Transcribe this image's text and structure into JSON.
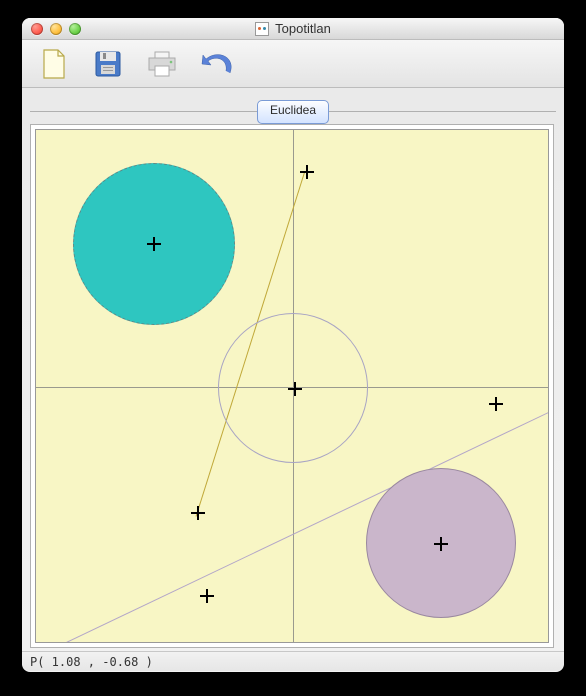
{
  "window": {
    "title": "Topotitlan"
  },
  "toolbar": {
    "new_label": "New",
    "save_label": "Save",
    "print_label": "Print",
    "undo_label": "Undo"
  },
  "tab": {
    "label": "Euclidea"
  },
  "status": {
    "text": "P( 1.08 , -0.68 )"
  },
  "geometry": {
    "axes": {
      "type": "cartesian"
    },
    "circles": [
      {
        "id": "teal-filled",
        "center_approx": [
          -0.95,
          0.95
        ],
        "filled": true
      },
      {
        "id": "center-outline",
        "center_approx": [
          0.0,
          0.0
        ],
        "filled": false
      },
      {
        "id": "lavender-filled",
        "center_approx": [
          1.0,
          -1.0
        ],
        "filled": true
      }
    ],
    "points": [
      {
        "approx": [
          -0.95,
          0.95
        ]
      },
      {
        "approx": [
          0.21,
          1.42
        ]
      },
      {
        "approx": [
          0.0,
          0.0
        ]
      },
      {
        "approx": [
          1.37,
          -0.1
        ]
      },
      {
        "approx": [
          -0.6,
          -0.82
        ]
      },
      {
        "approx": [
          -0.55,
          -1.37
        ]
      },
      {
        "approx": [
          1.0,
          -1.0
        ]
      }
    ],
    "lines": [
      {
        "id": "yellow",
        "through_approx": [
          [
            -0.6,
            -0.82
          ],
          [
            0.21,
            1.42
          ]
        ]
      },
      {
        "id": "purple",
        "through_approx": [
          [
            -1.6,
            -1.8
          ],
          [
            1.5,
            -0.05
          ]
        ]
      }
    ]
  }
}
